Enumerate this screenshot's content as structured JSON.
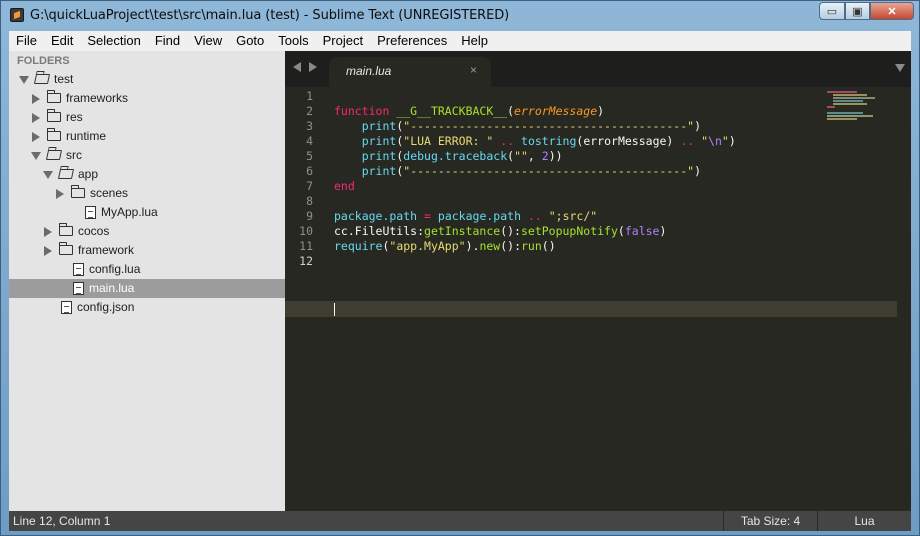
{
  "window": {
    "title": "G:\\quickLuaProject\\test\\src\\main.lua (test) - Sublime Text (UNREGISTERED)",
    "minimize_glyph": "▭",
    "maximize_glyph": "▣",
    "close_glyph": "✕"
  },
  "menu": [
    "File",
    "Edit",
    "Selection",
    "Find",
    "View",
    "Goto",
    "Tools",
    "Project",
    "Preferences",
    "Help"
  ],
  "sidebar": {
    "heading": "FOLDERS",
    "tree": [
      {
        "label": "test",
        "kind": "folder",
        "state": "open",
        "level": 0
      },
      {
        "label": "frameworks",
        "kind": "folder",
        "state": "closed",
        "level": 1
      },
      {
        "label": "res",
        "kind": "folder",
        "state": "closed",
        "level": 1
      },
      {
        "label": "runtime",
        "kind": "folder",
        "state": "closed",
        "level": 1
      },
      {
        "label": "src",
        "kind": "folder",
        "state": "open",
        "level": 1
      },
      {
        "label": "app",
        "kind": "folder",
        "state": "open",
        "level": 2
      },
      {
        "label": "scenes",
        "kind": "folder",
        "state": "closed",
        "level": 3
      },
      {
        "label": "MyApp.lua",
        "kind": "file",
        "level": 3
      },
      {
        "label": "cocos",
        "kind": "folder",
        "state": "closed",
        "level": 2
      },
      {
        "label": "framework",
        "kind": "folder",
        "state": "closed",
        "level": 2
      },
      {
        "label": "config.lua",
        "kind": "file",
        "level": 2
      },
      {
        "label": "main.lua",
        "kind": "file",
        "level": 2,
        "selected": true
      },
      {
        "label": "config.json",
        "kind": "file",
        "level": 1
      }
    ]
  },
  "editor": {
    "tab_label": "main.lua",
    "tab_close": "×",
    "line_numbers": [
      "1",
      "2",
      "3",
      "4",
      "5",
      "6",
      "7",
      "8",
      "9",
      "10",
      "11",
      "12"
    ],
    "current_line": 12
  },
  "code": {
    "l2": {
      "kw": "function",
      "name": "__G__TRACKBACK__",
      "open": "(",
      "param": "errorMessage",
      "close": ")"
    },
    "l3": {
      "fn": "print",
      "open": "(",
      "str": "\"----------------------------------------\"",
      "close": ")"
    },
    "l4": {
      "fn": "print",
      "open": "(",
      "str1": "\"LUA ERROR: \"",
      "op1": "..",
      "fn2": "tostring",
      "mid": "(errorMessage)",
      "op2": "..",
      "str2a": "\"",
      "esc": "\\n",
      "str2b": "\"",
      "close": ")"
    },
    "l5": {
      "fn": "print",
      "open": "(",
      "fn2": "debug.traceback",
      "open2": "(",
      "str": "\"\"",
      "comma": ", ",
      "num": "2",
      "close": "))"
    },
    "l6": {
      "fn": "print",
      "open": "(",
      "str": "\"----------------------------------------\"",
      "close": ")"
    },
    "l7": {
      "kw": "end"
    },
    "l9": {
      "lhs": "package.path",
      "eq": "=",
      "rhs": "package.path",
      "op": "..",
      "str": "\";src/\""
    },
    "l10": {
      "obj": "cc.FileUtils:",
      "m1": "getInstance",
      "mid": "():",
      "m2": "setPopupNotify",
      "open": "(",
      "val": "false",
      "close": ")"
    },
    "l11": {
      "fn": "require",
      "open": "(",
      "str": "\"app.MyApp\"",
      "mid": ").",
      "m1": "new",
      "mid2": "():",
      "m2": "run",
      "close": "()"
    }
  },
  "status": {
    "position": "Line 12, Column 1",
    "tab_size": "Tab Size: 4",
    "syntax": "Lua"
  },
  "colors": {
    "editor_bg": "#272822",
    "keyword": "#f92672",
    "function": "#a6e22e",
    "string": "#e6db74",
    "builtin": "#66d9ef",
    "number": "#ae81ff",
    "parameter": "#fd971f"
  }
}
